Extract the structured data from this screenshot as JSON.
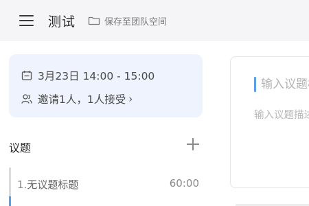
{
  "header": {
    "title": "测试",
    "save_to_team_label": "保存至团队空间"
  },
  "meeting": {
    "time": "3月23日 14:00 - 15:00",
    "invite": "邀请1人，1人接受",
    "invite_chevron": "›"
  },
  "agenda": {
    "label": "议题",
    "items": [
      {
        "number": "1.",
        "title": "无议题标题",
        "duration": "60:00"
      }
    ]
  },
  "editor": {
    "title_placeholder": "输入议题标题",
    "desc_placeholder": "输入议题描述"
  },
  "colors": {
    "accent": "#5a9fe8",
    "card_bg": "#eef3fd",
    "topbar_bg": "#f5f5f7"
  },
  "icons": [
    "menu-icon",
    "folder-icon",
    "calendar-icon",
    "people-icon",
    "chevron-right-icon",
    "plus-icon"
  ]
}
